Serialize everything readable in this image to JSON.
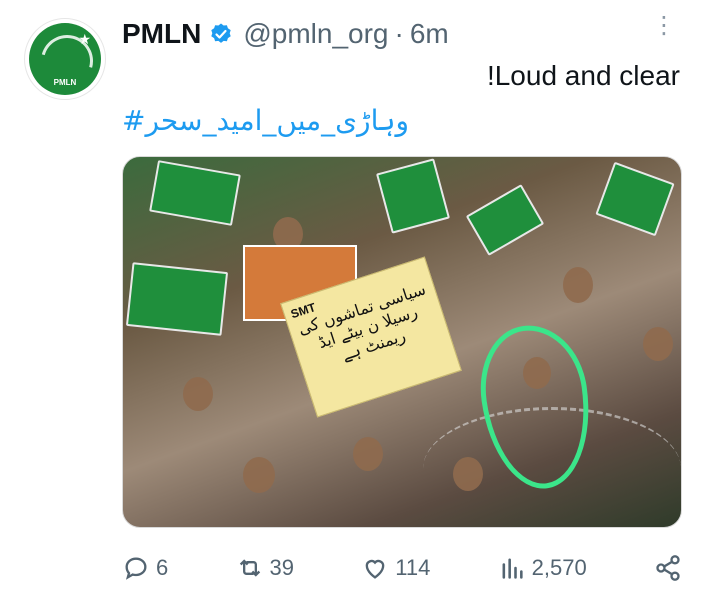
{
  "account": {
    "name": "PMLN",
    "handle": "@pmln_org",
    "separator": "·",
    "time": "6m"
  },
  "tweet": {
    "text": "!Loud and clear",
    "hashtag": "#وہاڑی_میں_امید_سحر"
  },
  "media": {
    "placard_text": "سیاسی تماشوں کی رسیلا ن بیٹے ایڈ ریمنٹ ہے",
    "poster_tag": "SMT"
  },
  "actions": {
    "replies": "6",
    "reposts": "39",
    "likes": "114",
    "views": "2,570"
  },
  "icons": {
    "avatar": "pmln-logo",
    "verified": "verified-badge-icon",
    "more": "more-options-icon",
    "reply": "reply-icon",
    "repost": "repost-icon",
    "like": "heart-icon",
    "views": "views-chart-icon",
    "share": "share-icon"
  },
  "colors": {
    "accent": "#1d9bf0",
    "annotation": "#3be58a",
    "muted": "#536471",
    "brand_green": "#1d8a3a"
  }
}
